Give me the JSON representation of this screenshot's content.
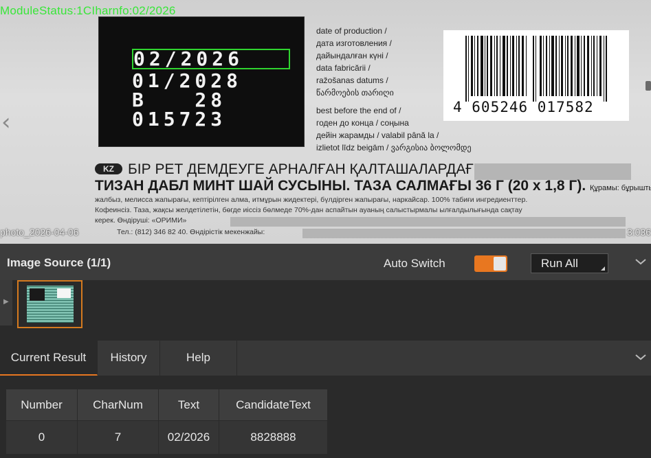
{
  "viewer": {
    "module_status": "ModuleStatus:1CIharnfo:02/2026",
    "nav_prev_icon": "chevron-left-icon",
    "photo_caption": "photo_2026-04-06",
    "photo_caption_right": "3:036",
    "lcd": {
      "boxed_line": "02/2026",
      "line2": "01/2028",
      "line3": "B   28",
      "line4": "015723"
    },
    "side_text": [
      "date of production /",
      "дата изготовления /",
      "дайындалған күні /",
      "data fabricării /",
      "ražošanas datums /",
      "წარმოების თარიღი",
      "best before the end of /",
      "годен до конца / соңына",
      "дейін жарамды / valabil până la /",
      "izlietot līdz beigām / ვარგისია ბოლომდე"
    ],
    "barcode_number": "4 605246 017582",
    "kz_badge": "KZ",
    "kz_line1": "БІР РЕТ ДЕМДЕУГЕ АРНАЛҒАН ҚАЛТАШАЛАРДАҒЫ",
    "kz_line2": "ТИЗАН ДАБЛ МИНТ ШАЙ СУСЫНЫ. ТАЗА САЛМАҒЫ 36 Г (20 x 1,8 Г).",
    "kz_line2_tail": "Құрамы: бұрышты",
    "small_lines": [
      "жалбыз, мелисса жапырағы, кептірілген алма, итмұрын жидектері, бүлдірген жапырағы, наркайсар. 100% табиғи ингредиенттер.",
      "Кофеинсіз. Таза, жақсы желдетілетін, бөгде иіссіз бөлмеде 70%-дан аспайтын ауаның салыстырмалы ылғалдылығында сақтау",
      "керек. Өндіруші: «ОРИМИ»",
      "Тел.: (812) 346 82 40. Өндірістік мекенжайы:"
    ]
  },
  "source": {
    "title": "Image Source (1/1)",
    "auto_switch_label": "Auto Switch",
    "auto_switch_on": true,
    "run_all_label": "Run All",
    "collapse_icon": "chevron-down-icon",
    "accent_color": "#e87720"
  },
  "tabs": [
    {
      "label": "Current Result",
      "active": true
    },
    {
      "label": "History",
      "active": false
    },
    {
      "label": "Help",
      "active": false
    }
  ],
  "result_table": {
    "headers": [
      "Number",
      "CharNum",
      "Text",
      "CandidateText"
    ],
    "rows": [
      [
        "0",
        "7",
        "02/2026",
        "8828888"
      ]
    ]
  }
}
